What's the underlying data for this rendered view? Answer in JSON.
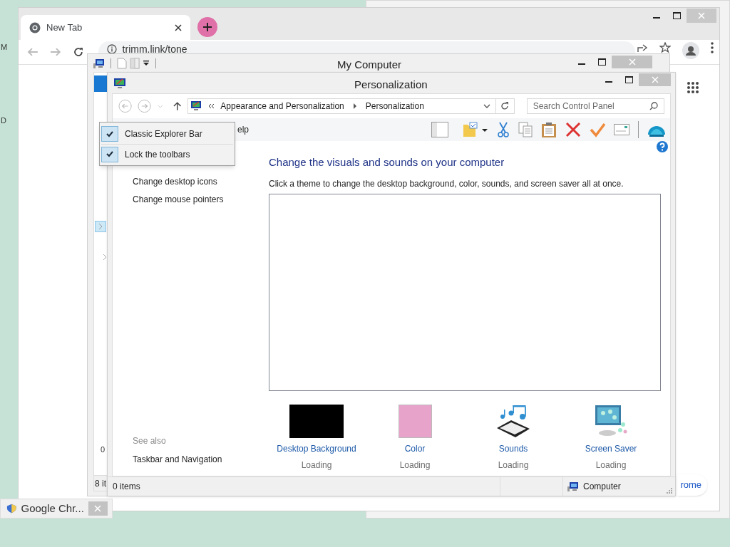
{
  "desktop_labels": [
    "M",
    "D"
  ],
  "chrome": {
    "tab_title": "New Tab",
    "address": "trimm.link/tone",
    "corner_button": "rome"
  },
  "my_computer": {
    "title": "My Computer",
    "partial_texts": [
      "0",
      "8 it"
    ]
  },
  "personalization": {
    "title": "Personalization",
    "breadcrumb": [
      "Appearance and Personalization",
      "Personalization"
    ],
    "search_placeholder": "Search Control Panel",
    "menu_fragment": "elp",
    "sidebar_links": [
      "Change desktop icons",
      "Change mouse pointers"
    ],
    "see_also_label": "See also",
    "see_also_links": [
      "Taskbar and Navigation"
    ],
    "heading": "Change the visuals and sounds on your computer",
    "description": "Click a theme to change the desktop background, color, sounds, and screen saver all at once.",
    "items": [
      {
        "kind": "swatch",
        "color": "#000000",
        "label": "Desktop Background",
        "status": "Loading"
      },
      {
        "kind": "swatch",
        "color": "#e8a3cb",
        "label": "Color",
        "status": "Loading"
      },
      {
        "kind": "sounds",
        "label": "Sounds",
        "status": "Loading"
      },
      {
        "kind": "screensaver",
        "label": "Screen Saver",
        "status": "Loading"
      }
    ],
    "status_bar": {
      "count": "0 items",
      "location": "Computer"
    }
  },
  "context_menu": [
    {
      "label": "Classic Explorer Bar",
      "checked": true
    },
    {
      "label": "Lock the toolbars",
      "checked": true
    }
  ],
  "taskbar_thumbnail": {
    "title": "Google Chr..."
  }
}
